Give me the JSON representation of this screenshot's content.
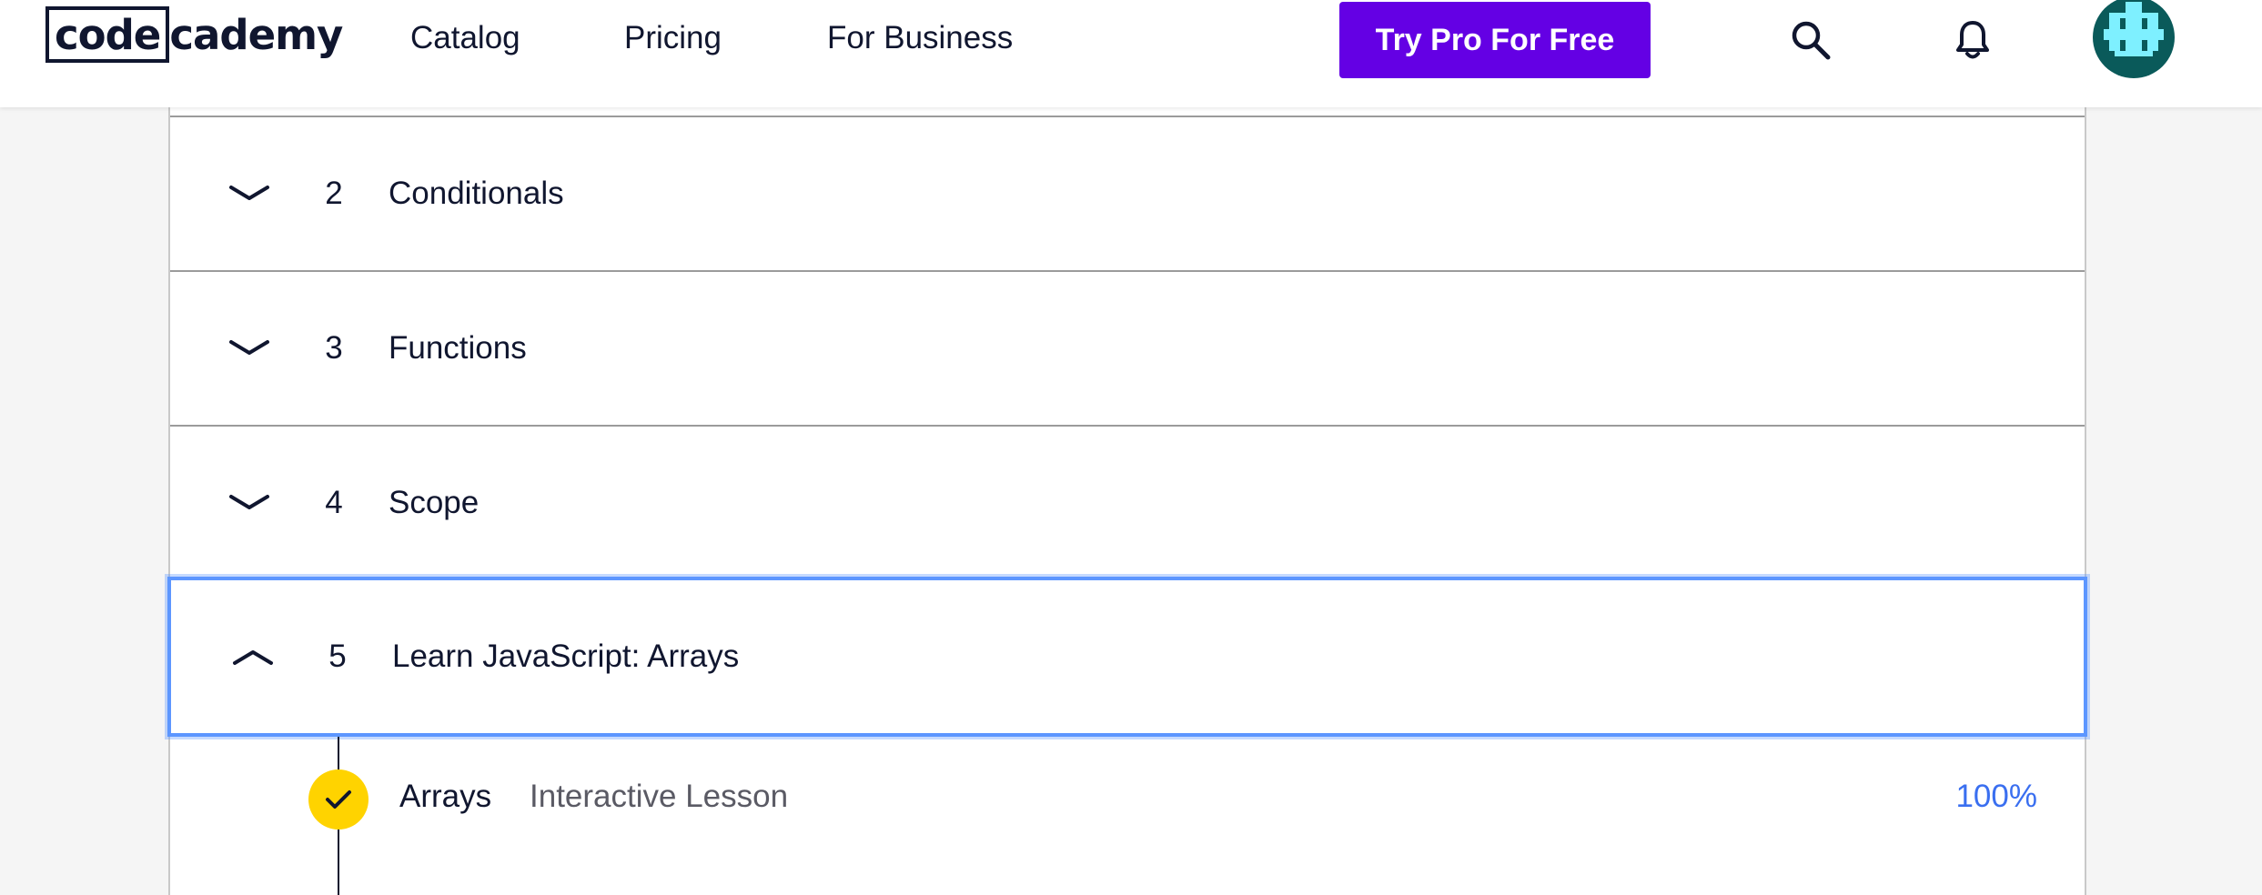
{
  "header": {
    "logo_boxed": "code",
    "logo_rest": "cademy",
    "nav": [
      "Catalog",
      "Pricing",
      "For Business"
    ],
    "cta_label": "Try Pro For Free",
    "icons": [
      "search-icon",
      "bell-icon",
      "avatar"
    ],
    "colors": {
      "cta_bg": "#6400e4",
      "avatar_bg": "#0a5a5a",
      "avatar_fg": "#7ef0ff"
    }
  },
  "modules": [
    {
      "number": "2",
      "title": "Conditionals",
      "state": "collapsed"
    },
    {
      "number": "3",
      "title": "Functions",
      "state": "collapsed"
    },
    {
      "number": "4",
      "title": "Scope",
      "state": "collapsed"
    },
    {
      "number": "5",
      "title": "Learn JavaScript: Arrays",
      "state": "expanded"
    }
  ],
  "lessons": [
    {
      "name": "Arrays",
      "type": "Interactive Lesson",
      "progress": "100%",
      "completed": true
    }
  ],
  "colors": {
    "focus_ring": "#5c96ff",
    "check_bg": "#ffd300",
    "progress_text": "#3a6ff0"
  }
}
